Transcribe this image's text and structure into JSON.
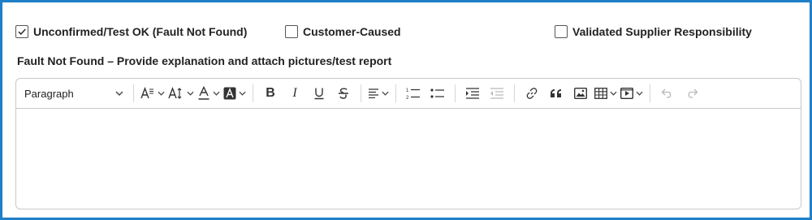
{
  "checkboxes": [
    {
      "label": "Unconfirmed/Test OK (Fault Not Found)",
      "checked": true
    },
    {
      "label": "Customer-Caused",
      "checked": false
    },
    {
      "label": "Validated Supplier Responsibility",
      "checked": false
    }
  ],
  "section_title": "Fault Not Found – Provide explanation and attach pictures/test report",
  "editor": {
    "block_format": "Paragraph",
    "content": "",
    "toolbar_icons": [
      "chevron-down-icon",
      "font-size-icon",
      "line-height-icon",
      "font-color-icon",
      "highlight-color-icon",
      "bold-icon",
      "italic-icon",
      "underline-icon",
      "strikethrough-icon",
      "align-icon",
      "numbered-list-icon",
      "bullet-list-icon",
      "indent-icon",
      "outdent-icon",
      "link-icon",
      "blockquote-icon",
      "image-icon",
      "table-icon",
      "media-icon",
      "undo-icon",
      "redo-icon"
    ]
  },
  "colors": {
    "frame_border": "#1f7fc7",
    "border": "#c8c8c8",
    "text": "#222222"
  }
}
